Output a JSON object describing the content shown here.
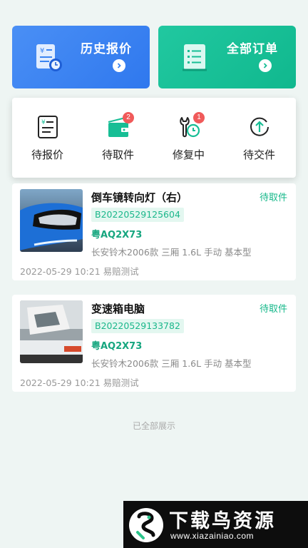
{
  "shortcuts": [
    {
      "label": "历史报价",
      "icon": "quote-history-icon"
    },
    {
      "label": "全部订单",
      "icon": "all-orders-icon"
    }
  ],
  "status_tabs": [
    {
      "label": "待报价",
      "icon": "pending-quote-icon",
      "badge": ""
    },
    {
      "label": "待取件",
      "icon": "pending-pickup-icon",
      "badge": "2"
    },
    {
      "label": "修复中",
      "icon": "repairing-icon",
      "badge": "1"
    },
    {
      "label": "待交件",
      "icon": "pending-delivery-icon",
      "badge": ""
    }
  ],
  "orders": [
    {
      "title": "倒车镜转向灯（右）",
      "status": "待取件",
      "code": "B20220529125604",
      "plate": "粤AQ2X73",
      "model": "长安铃木2006款 三厢 1.6L 手动 基本型",
      "meta": "2022-05-29 10:21 易赔测试"
    },
    {
      "title": "变速箱电脑",
      "status": "待取件",
      "code": "B20220529133782",
      "plate": "粤AQ2X73",
      "model": "长安铃木2006款 三厢 1.6L 手动 基本型",
      "meta": "2022-05-29 10:21 易赔测试"
    }
  ],
  "end_note": "已全部展示",
  "watermark": {
    "title": "下载鸟资源",
    "url": "www.xiazainiao.com"
  },
  "colors": {
    "blue": "#3a84f2",
    "green": "#17be95",
    "accent_text": "#16b88a",
    "badge": "#f05a5a"
  }
}
